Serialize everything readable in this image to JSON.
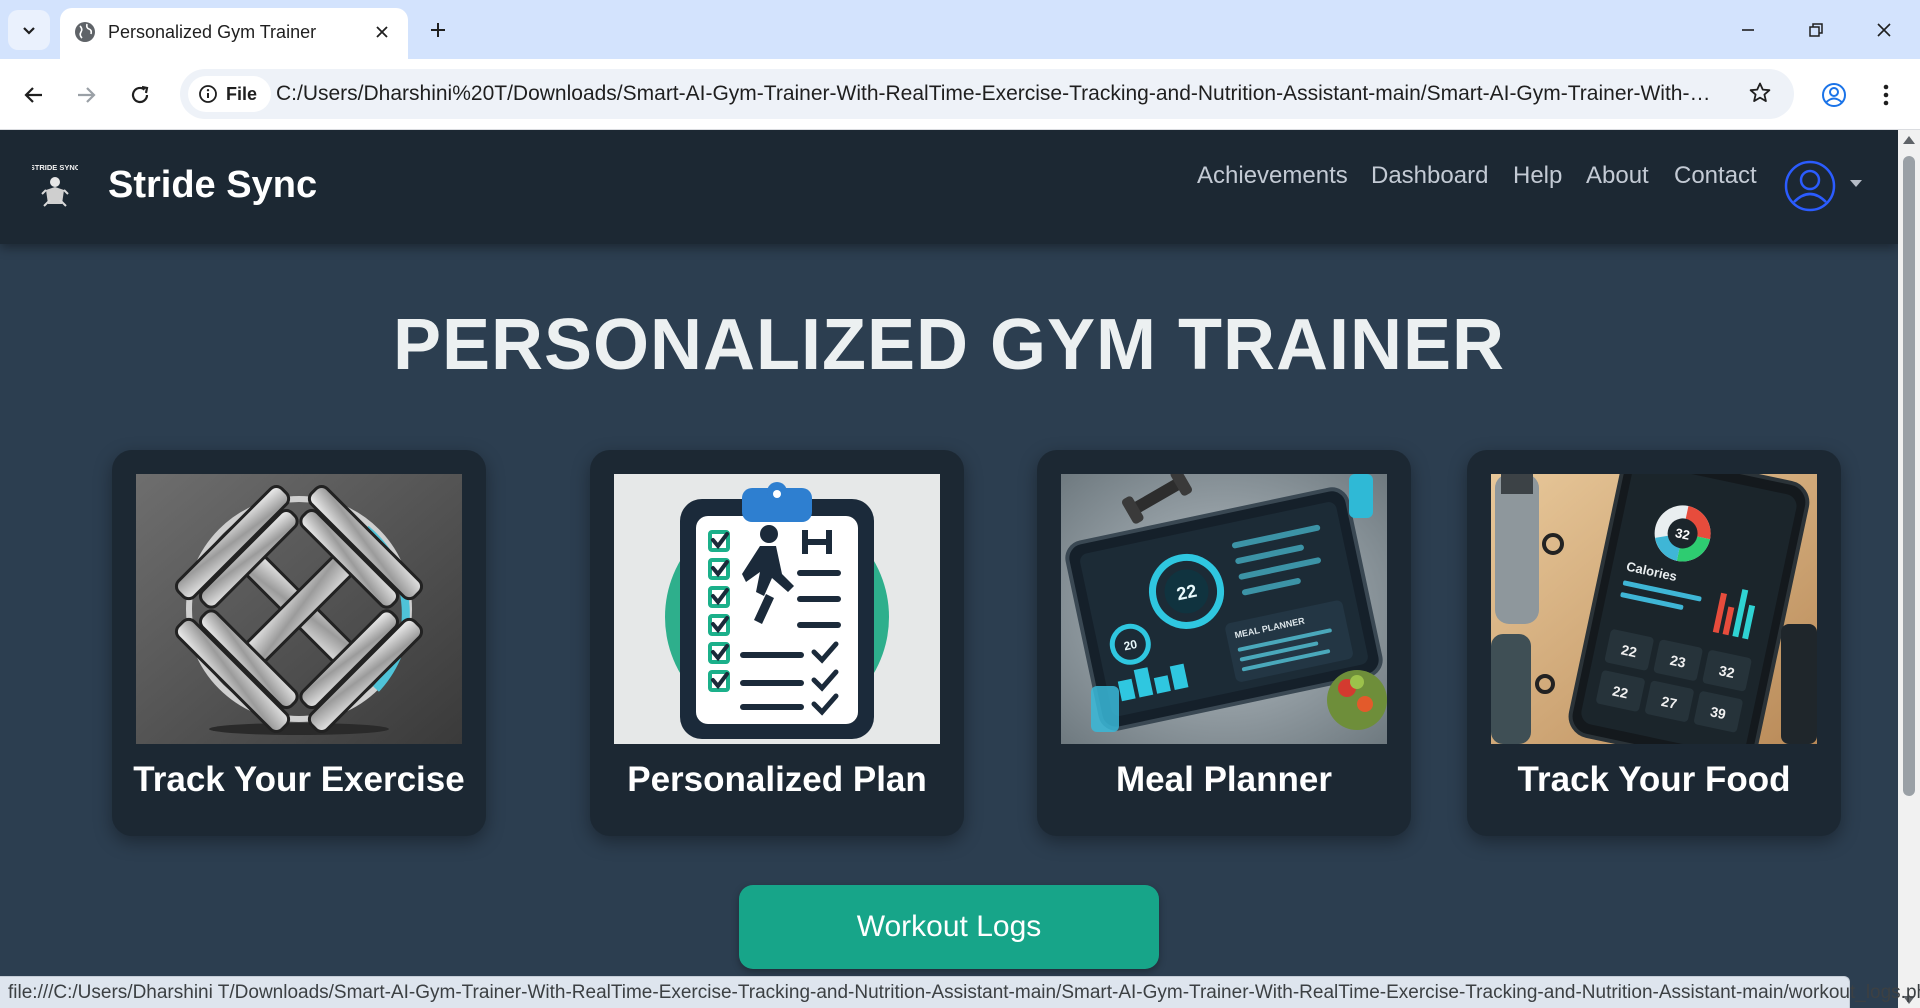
{
  "browser": {
    "tab_title": "Personalized Gym Trainer",
    "site_info_label": "File",
    "url": "C:/Users/Dharshini%20T/Downloads/Smart-AI-Gym-Trainer-With-RealTime-Exercise-Tracking-and-Nutrition-Assistant-main/Smart-AI-Gym-Trainer-With-Re...",
    "status_url": "file:///C:/Users/Dharshini T/Downloads/Smart-AI-Gym-Trainer-With-RealTime-Exercise-Tracking-and-Nutrition-Assistant-main/Smart-AI-Gym-Trainer-With-RealTime-Exercise-Tracking-and-Nutrition-Assistant-main/workout_logs.php"
  },
  "site": {
    "brand": "Stride Sync",
    "logo_text": "STRIDE SYNC",
    "nav": [
      "Achievements",
      "Dashboard",
      "Help",
      "About",
      "Contact"
    ]
  },
  "hero": {
    "title": "PERSONALIZED GYM TRAINER"
  },
  "cards": [
    {
      "label": "Track Your Exercise",
      "icon": "dumbbell-icon"
    },
    {
      "label": "Personalized Plan",
      "icon": "clipboard-icon"
    },
    {
      "label": "Meal Planner",
      "icon": "tablet-dashboard-icon"
    },
    {
      "label": "Track Your Food",
      "icon": "phone-calorie-icon"
    }
  ],
  "meal_image": {
    "screen_numbers": [
      "22",
      "20"
    ],
    "panel_title": "MEAL PLANNER"
  },
  "food_image": {
    "screen_title": "Calories",
    "gauge_value": "32",
    "tiles": [
      "22",
      "23",
      "32",
      "22",
      "27",
      "39"
    ]
  },
  "buttons": {
    "workout_logs": "Workout Logs"
  },
  "colors": {
    "nav_bg": "#1c2833",
    "page_bg": "#2c3e50",
    "accent": "#17a589",
    "avatar": "#2b5cff"
  }
}
